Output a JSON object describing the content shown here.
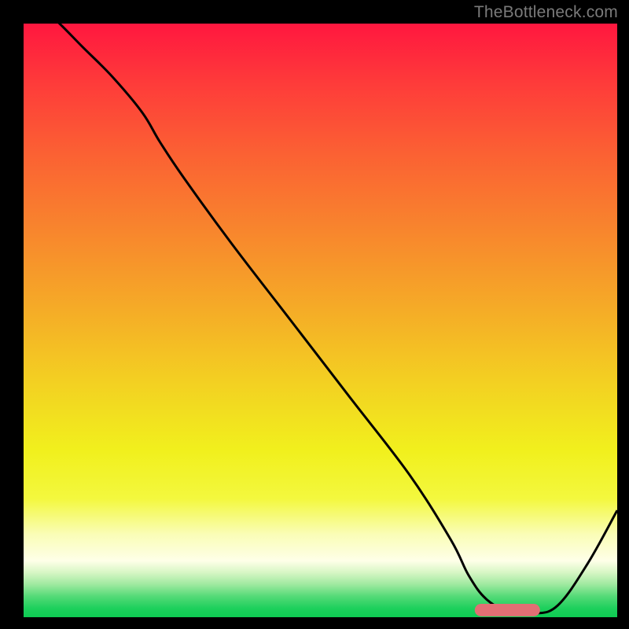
{
  "watermark": "TheBottleneck.com",
  "palette": {
    "frame": "#000000",
    "curve": "#000000",
    "marker": "#e26f74",
    "gradient_stops": [
      {
        "offset": 0.0,
        "color": "#ff173f"
      },
      {
        "offset": 0.1,
        "color": "#fe3b3a"
      },
      {
        "offset": 0.22,
        "color": "#fb6133"
      },
      {
        "offset": 0.35,
        "color": "#f8862d"
      },
      {
        "offset": 0.48,
        "color": "#f5ab27"
      },
      {
        "offset": 0.6,
        "color": "#f3cf22"
      },
      {
        "offset": 0.72,
        "color": "#f1f01d"
      },
      {
        "offset": 0.8,
        "color": "#f3f83e"
      },
      {
        "offset": 0.86,
        "color": "#fafdb6"
      },
      {
        "offset": 0.905,
        "color": "#feffe8"
      },
      {
        "offset": 0.925,
        "color": "#d6f6c4"
      },
      {
        "offset": 0.945,
        "color": "#9ee99f"
      },
      {
        "offset": 0.965,
        "color": "#54da77"
      },
      {
        "offset": 0.985,
        "color": "#1dd05c"
      },
      {
        "offset": 1.0,
        "color": "#0ecc53"
      }
    ]
  },
  "chart_data": {
    "type": "line",
    "title": "",
    "xlabel": "",
    "ylabel": "",
    "x_range": [
      0,
      100
    ],
    "y_range": [
      0,
      100
    ],
    "series": [
      {
        "name": "bottleneck-curve",
        "x": [
          0,
          5,
          10,
          15,
          20,
          23,
          27,
          35,
          45,
          55,
          65,
          72,
          75,
          78,
          82,
          86,
          90,
          95,
          100
        ],
        "y": [
          105,
          101,
          96,
          91,
          85,
          80,
          74,
          63,
          50,
          37,
          24,
          13,
          7,
          3,
          0.8,
          0.6,
          2,
          9,
          18
        ]
      }
    ],
    "marker": {
      "name": "optimal-range",
      "x_start": 76,
      "x_end": 87,
      "y": 1.2,
      "thickness_pct": 2.1
    }
  }
}
